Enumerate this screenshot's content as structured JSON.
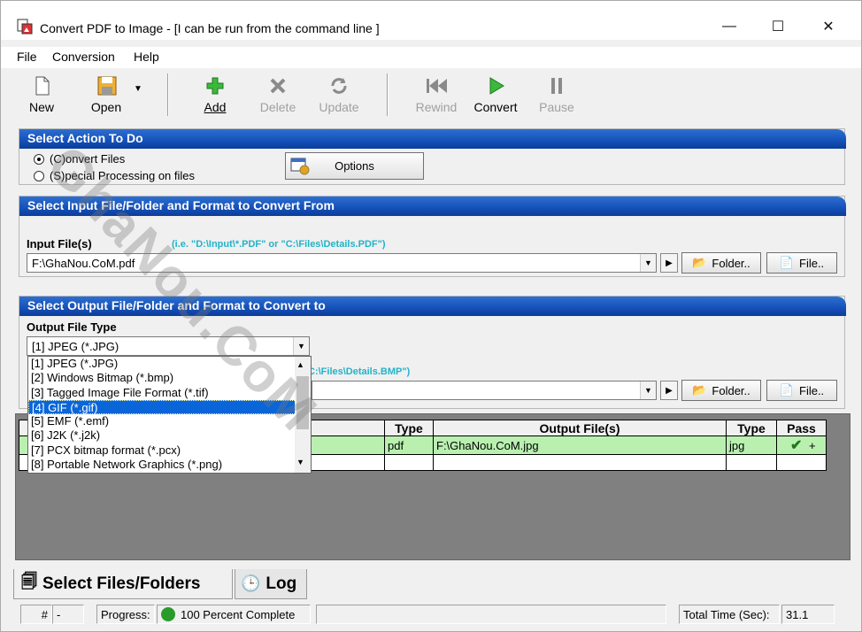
{
  "window": {
    "title": "Convert PDF to Image - [I can be run from the command line ]",
    "controls": {
      "minimize": "—",
      "maximize": "☐",
      "close": "✕"
    }
  },
  "menu": [
    "File",
    "Conversion",
    "Help"
  ],
  "toolbar": {
    "new": "New",
    "open": "Open",
    "add": "Add",
    "delete": "Delete",
    "update": "Update",
    "rewind": "Rewind",
    "convert": "Convert",
    "pause": "Pause"
  },
  "action_panel": {
    "header": "Select Action To Do",
    "radio_convert": "(C)onvert Files",
    "radio_special": "(S)pecial Processing on files",
    "options_button": "Options"
  },
  "input_panel": {
    "header": "Select Input File/Folder and Format to Convert From",
    "label": "Input File(s)",
    "hint": "(i.e. \"D:\\Input\\*.PDF\"  or  \"C:\\Files\\Details.PDF\")",
    "value": "F:\\GhaNou.CoM.pdf",
    "folder_button": "Folder..",
    "file_button": "File.."
  },
  "output_panel": {
    "header": "Select Output File/Folder and Format to Convert to",
    "type_label": "Output File Type",
    "type_value": "[1] JPEG (*.JPG)",
    "hint_partial": "C:\\Files\\Details.BMP\")",
    "folder_button": "Folder..",
    "file_button": "File.."
  },
  "type_options": [
    "[1] JPEG (*.JPG)",
    "[2] Windows Bitmap (*.bmp)",
    "[3] Tagged Image File Format (*.tif)",
    "[4] GIF (*.gif)",
    "[5] EMF (*.emf)",
    "[6] J2K (*.j2k)",
    "[7] PCX bitmap format (*.pcx)",
    "[8] Portable Network Graphics (*.png)"
  ],
  "grid": {
    "headers": {
      "type1": "Type",
      "output": "Output File(s)",
      "type2": "Type",
      "pass": "Pass"
    },
    "row": {
      "type1": "pdf",
      "output": "F:\\GhaNou.CoM.jpg",
      "type2": "jpg",
      "pass_plus": "+"
    }
  },
  "tabs": {
    "files": "Select Files/Folders",
    "log": "Log"
  },
  "status": {
    "hash": "#",
    "dash": "-",
    "progress_label": "Progress:",
    "progress_text": "100 Percent Complete",
    "time_label": "Total Time (Sec):",
    "time_value": "31.1"
  },
  "watermark": "GhaNou.CoM",
  "colors": {
    "header_blue": "#1450b8",
    "selected_row": "#b9f0b0",
    "hint": "#22b3c8",
    "highlight": "#0a66d8"
  }
}
